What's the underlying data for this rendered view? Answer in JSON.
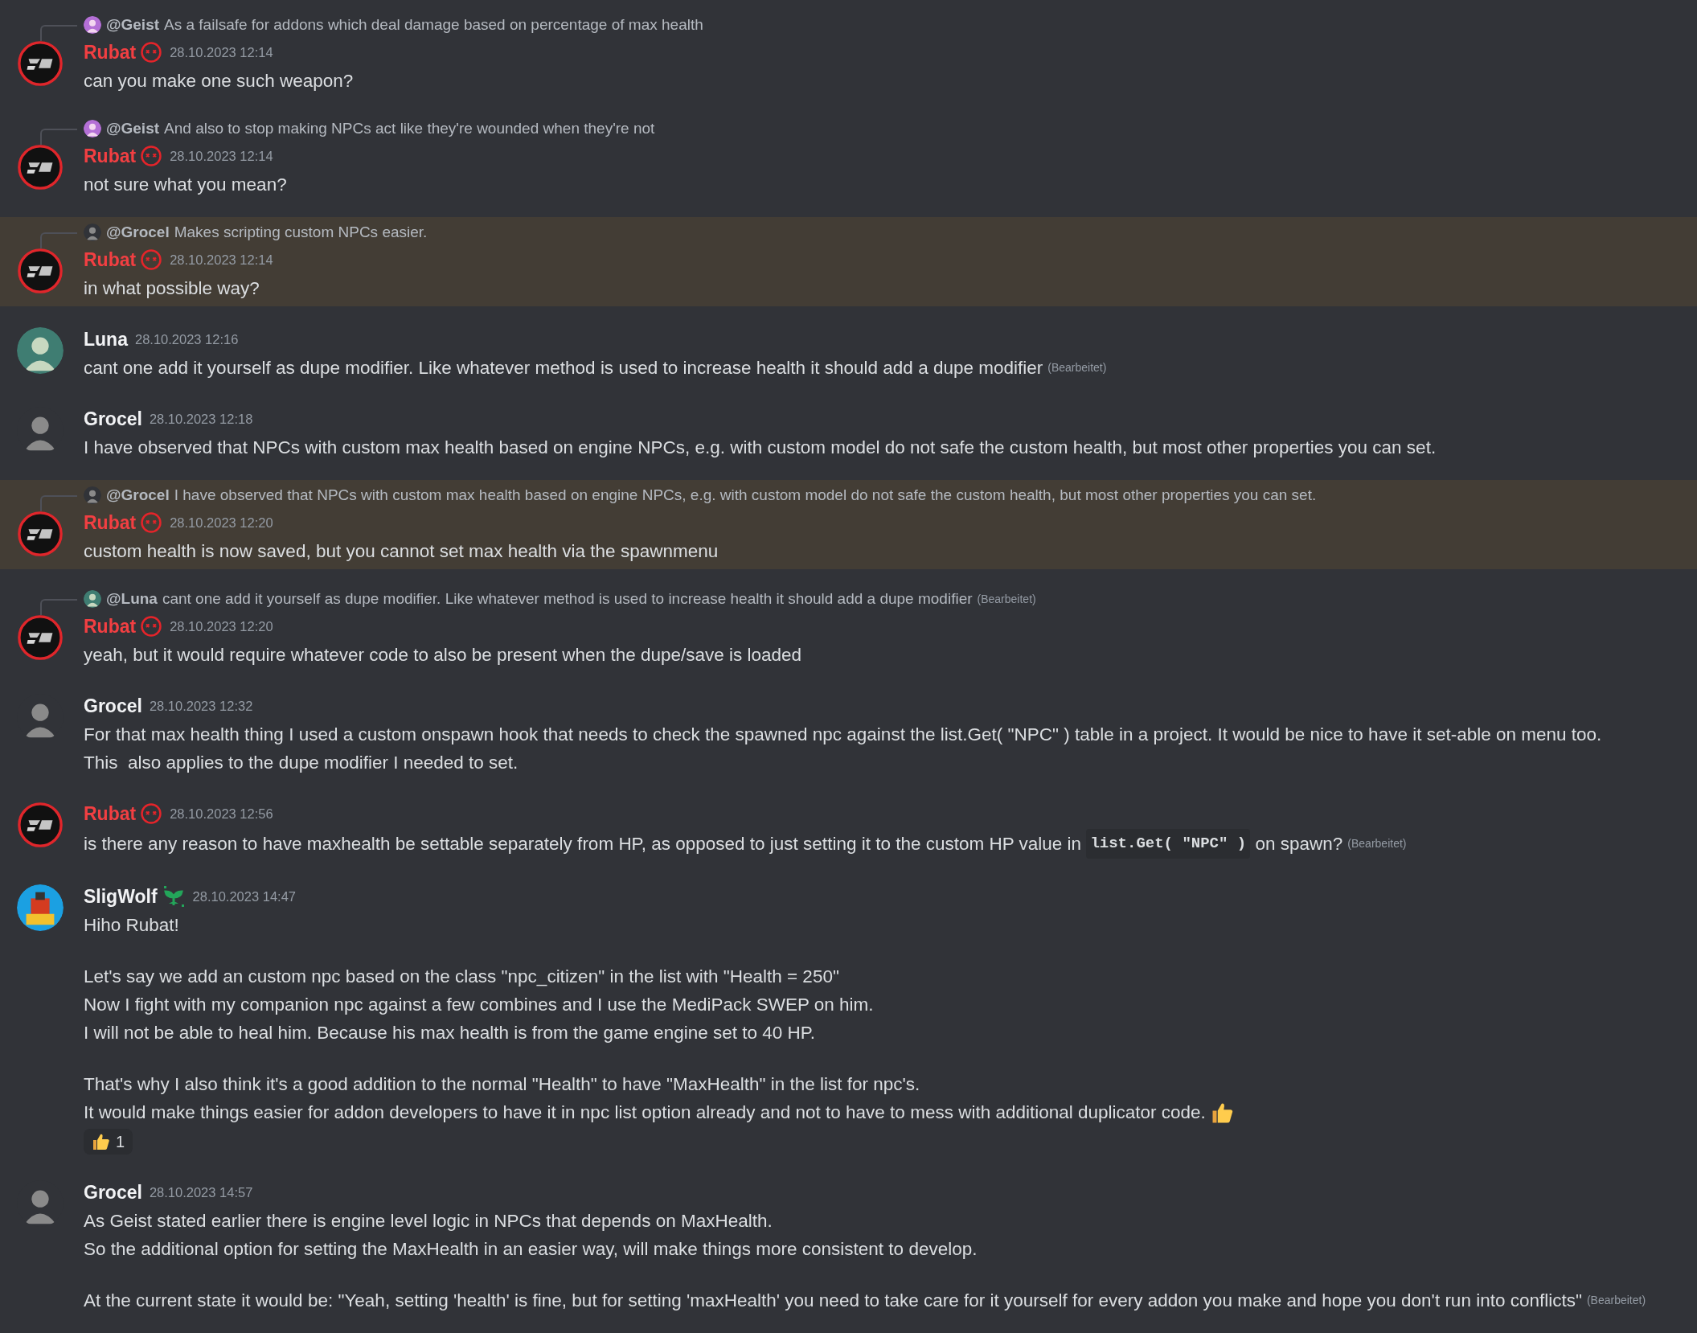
{
  "messages": [
    {
      "reply": {
        "avatar": {
          "kind": "purple-figure"
        },
        "author": "@Geist",
        "text": "As a failsafe for addons which deal damage based on percentage of max health"
      },
      "avatar": {
        "kind": "rb-logo"
      },
      "author": "Rubat",
      "color": "#f23f42",
      "badge": {
        "kind": "x-eyes"
      },
      "timestamp": "28.10.2023 12:14",
      "highlighted": false,
      "paragraphs": [
        [
          "can you make one such weapon?"
        ]
      ]
    },
    {
      "reply": {
        "avatar": {
          "kind": "purple-figure"
        },
        "author": "@Geist",
        "text": "And also to stop making NPCs act like they're wounded when they're not"
      },
      "avatar": {
        "kind": "rb-logo"
      },
      "author": "Rubat",
      "color": "#f23f42",
      "badge": {
        "kind": "x-eyes"
      },
      "timestamp": "28.10.2023 12:14",
      "highlighted": false,
      "paragraphs": [
        [
          "not sure what you mean?"
        ]
      ]
    },
    {
      "reply": {
        "avatar": {
          "kind": "dark-portrait"
        },
        "author": "@Grocel",
        "text": "Makes scripting custom NPCs easier."
      },
      "avatar": {
        "kind": "rb-logo"
      },
      "author": "Rubat",
      "color": "#f23f42",
      "badge": {
        "kind": "x-eyes"
      },
      "timestamp": "28.10.2023 12:14",
      "highlighted": true,
      "paragraphs": [
        [
          "in what possible way?"
        ]
      ]
    },
    {
      "avatar": {
        "kind": "teal-figure"
      },
      "author": "Luna",
      "color": "#f2f3f5",
      "timestamp": "28.10.2023 12:16",
      "highlighted": false,
      "edited": "(Bearbeitet)",
      "paragraphs": [
        [
          "cant one add it yourself as dupe modifier. Like whatever method is used to increase health it should add a dupe modifier"
        ]
      ]
    },
    {
      "avatar": {
        "kind": "dark-portrait"
      },
      "author": "Grocel",
      "color": "#f2f3f5",
      "timestamp": "28.10.2023 12:18",
      "highlighted": false,
      "paragraphs": [
        [
          "I have observed that NPCs with custom max health based on engine NPCs, e.g. with custom model do not safe the custom health, but most other properties you can set."
        ]
      ]
    },
    {
      "reply": {
        "avatar": {
          "kind": "dark-portrait"
        },
        "author": "@Grocel",
        "text": "I have observed that NPCs with custom max health based on engine NPCs, e.g. with custom model do not safe the custom health, but most other properties you can set."
      },
      "avatar": {
        "kind": "rb-logo"
      },
      "author": "Rubat",
      "color": "#f23f42",
      "badge": {
        "kind": "x-eyes"
      },
      "timestamp": "28.10.2023 12:20",
      "highlighted": true,
      "paragraphs": [
        [
          "custom health is now saved, but you cannot set max health via the spawnmenu"
        ]
      ]
    },
    {
      "reply": {
        "avatar": {
          "kind": "teal-figure"
        },
        "author": "@Luna",
        "text": "cant one add it yourself as dupe modifier. Like whatever method is used to increase health it should add a dupe modifier",
        "edited": "(Bearbeitet)"
      },
      "avatar": {
        "kind": "rb-logo"
      },
      "author": "Rubat",
      "color": "#f23f42",
      "badge": {
        "kind": "x-eyes"
      },
      "timestamp": "28.10.2023 12:20",
      "highlighted": false,
      "paragraphs": [
        [
          "yeah, but it would require whatever code to also be present when the dupe/save is loaded"
        ]
      ]
    },
    {
      "avatar": {
        "kind": "dark-portrait"
      },
      "author": "Grocel",
      "color": "#f2f3f5",
      "timestamp": "28.10.2023 12:32",
      "highlighted": false,
      "paragraphs": [
        [
          "For that max health thing I used a custom onspawn hook that needs to check the spawned npc against the list.Get( \"NPC\" ) table in a project. It would be nice to have it set-able on menu too.",
          "This  also applies to the dupe modifier I needed to set."
        ]
      ]
    },
    {
      "avatar": {
        "kind": "rb-logo"
      },
      "author": "Rubat",
      "color": "#f23f42",
      "badge": {
        "kind": "x-eyes"
      },
      "timestamp": "28.10.2023 12:56",
      "highlighted": false,
      "edited": "(Bearbeitet)",
      "paragraphs": [
        [
          {
            "parts": [
              {
                "kind": "text",
                "text": "is there any reason to have maxhealth be settable separately from HP, as opposed to just setting it to the custom HP value in "
              },
              {
                "kind": "code",
                "text": "list.Get( \"NPC\" )"
              },
              {
                "kind": "text",
                "text": " on spawn?"
              }
            ]
          }
        ]
      ]
    },
    {
      "avatar": {
        "kind": "robot"
      },
      "author": "SligWolf",
      "color": "#f2f3f5",
      "badge": {
        "kind": "sprout"
      },
      "timestamp": "28.10.2023 14:47",
      "highlighted": false,
      "trailing_emoji": {
        "kind": "thumbs-up"
      },
      "paragraphs": [
        [
          "Hiho Rubat!"
        ],
        [
          "Let's say we add an custom npc based on the class \"npc_citizen\" in the list with \"Health = 250\"",
          "Now I fight with my companion npc against a few combines and I use the MediPack SWEP on him.",
          "I will not be able to heal him. Because his max health is from the game engine set to 40 HP."
        ],
        [
          "That's why I also think it's a good addition to the normal \"Health\" to have \"MaxHealth\" in the list for npc's.",
          "It would make things easier for addon developers to have it in npc list option already and not to have to mess with additional duplicator code."
        ]
      ],
      "reactions": [
        {
          "emoji": {
            "kind": "thumbs-up"
          },
          "count": "1"
        }
      ]
    },
    {
      "avatar": {
        "kind": "dark-portrait"
      },
      "author": "Grocel",
      "color": "#f2f3f5",
      "timestamp": "28.10.2023 14:57",
      "highlighted": false,
      "edited": "(Bearbeitet)",
      "paragraphs": [
        [
          "As Geist stated earlier there is engine level logic in NPCs that depends on MaxHealth.",
          "So the additional option for setting the MaxHealth in an easier way, will make things more consistent to develop."
        ],
        [
          "At the current state it would be: \"Yeah, setting 'health' is fine, but for setting 'maxHealth' you need to take care for it yourself for every addon you make and hope you don't run into conflicts\""
        ]
      ]
    }
  ]
}
